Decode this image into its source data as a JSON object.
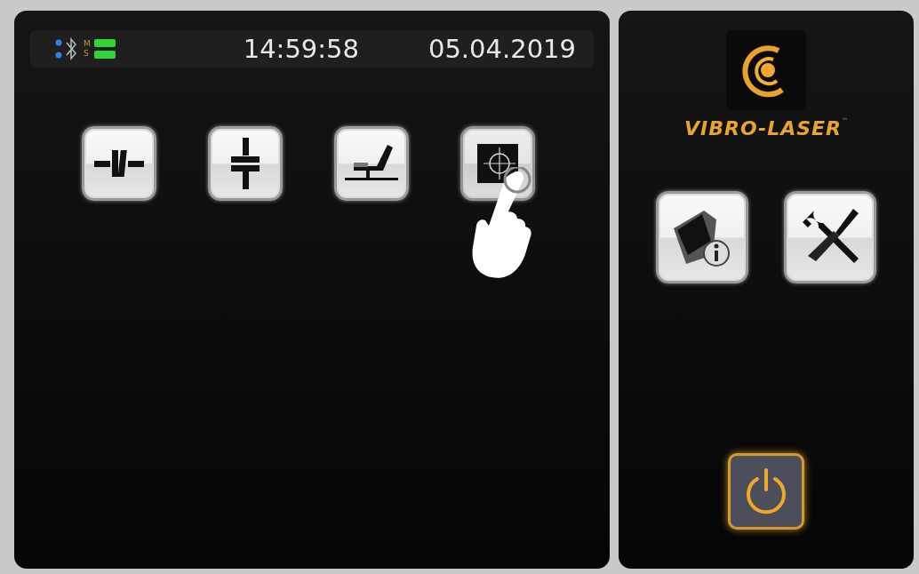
{
  "status_bar": {
    "link_labels": [
      "M",
      "S"
    ],
    "time": "14:59:58",
    "date": "05.04.2019"
  },
  "measure_buttons": [
    {
      "kind": "horizontal",
      "touched": false
    },
    {
      "kind": "vertical",
      "touched": false
    },
    {
      "kind": "machine",
      "touched": false
    },
    {
      "kind": "target",
      "touched": true
    }
  ],
  "brand": {
    "name": "VIBRO-LASER",
    "mark": "™"
  },
  "side_buttons": [
    {
      "kind": "info"
    },
    {
      "kind": "tools"
    }
  ],
  "power_button": {
    "kind": "power"
  }
}
